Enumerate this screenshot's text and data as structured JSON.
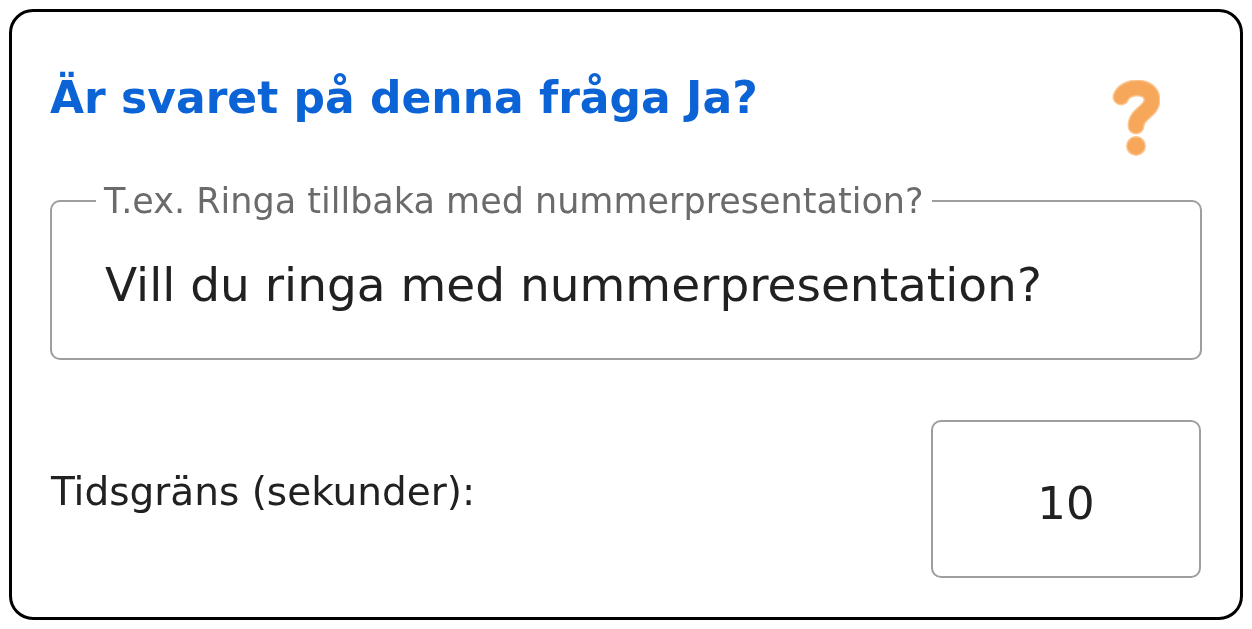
{
  "card": {
    "title": "Är svaret på denna fråga Ja?",
    "question_field": {
      "label": "T.ex. Ringa tillbaka med nummerpresentation?",
      "value": "Vill du ringa med nummerpresentation?"
    },
    "time_limit": {
      "label": "Tidsgräns (sekunder):",
      "value": "10"
    }
  }
}
